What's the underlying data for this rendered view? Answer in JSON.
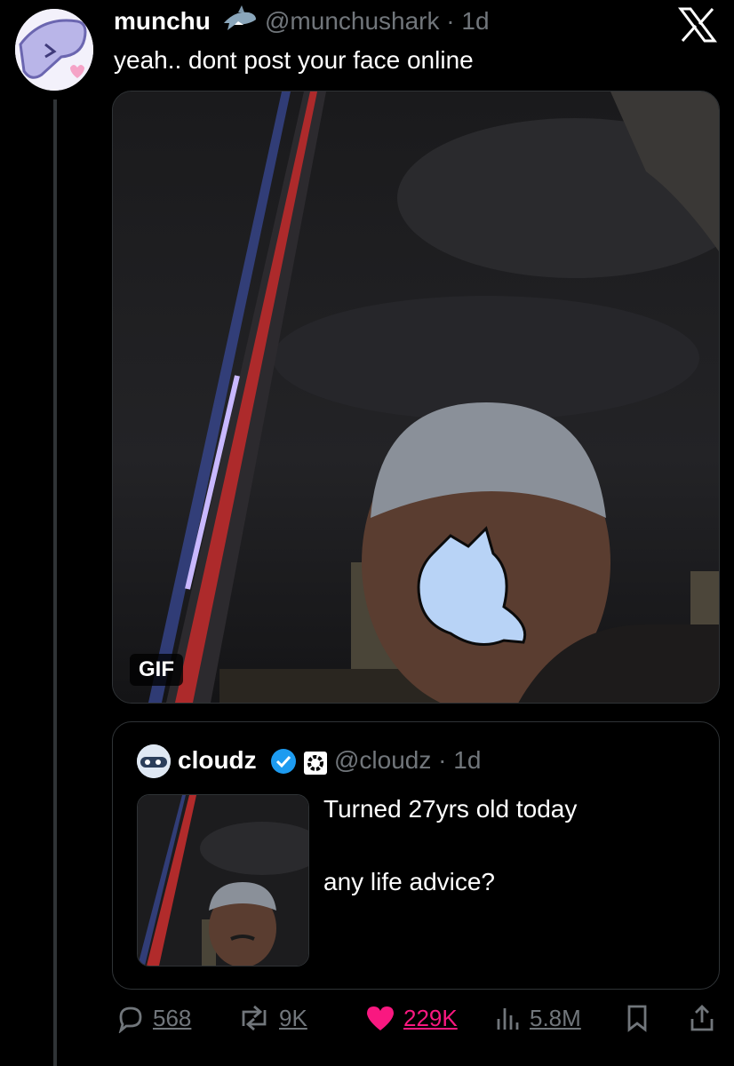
{
  "tweet": {
    "author": "munchu",
    "handle_time": "@munchushark · 1d",
    "text": "yeah.. dont post your face online",
    "media_badge": "GIF"
  },
  "quote": {
    "author": "cloudz",
    "handle_time": "@cloudz · 1d",
    "text": "Turned 27yrs old today\n\nany life advice?"
  },
  "actions": {
    "replies": "568",
    "reposts": "9K",
    "likes": "229K",
    "views": "5.8M"
  },
  "colors": {
    "background": "#000000",
    "secondary_text": "#71767b",
    "like": "#f91880",
    "verified": "#1d9bf0"
  },
  "icons": [
    "shark-emoji-icon",
    "x-logo-icon",
    "verified-badge-icon",
    "org-badge-icon",
    "reply-icon",
    "repost-icon",
    "like-icon",
    "views-icon",
    "bookmark-icon",
    "share-icon"
  ]
}
